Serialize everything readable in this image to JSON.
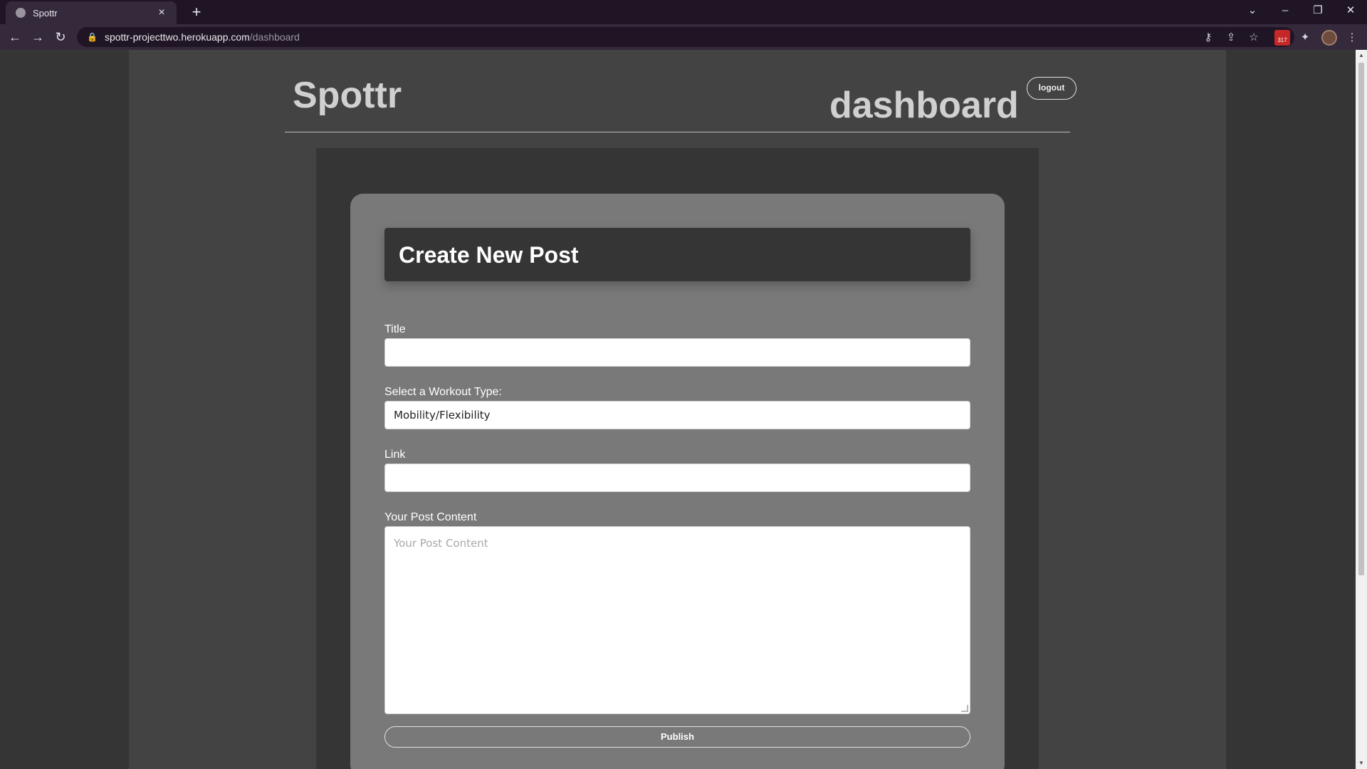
{
  "browser": {
    "tab_title": "Spottr",
    "url_host": "spottr-projecttwo.herokuapp.com",
    "url_path": "/dashboard",
    "extension_badge": "317"
  },
  "header": {
    "brand": "Spottr",
    "page_title": "dashboard",
    "logout_label": "logout"
  },
  "form": {
    "heading": "Create New Post",
    "title_label": "Title",
    "title_value": "",
    "workout_label": "Select a Workout Type:",
    "workout_value": "Mobility/Flexibility",
    "link_label": "Link",
    "link_value": "",
    "content_label": "Your Post Content",
    "content_placeholder": "Your Post Content",
    "publish_label": "Publish"
  },
  "icons": {
    "tab_favicon": "globe-icon",
    "back": "arrow-left-icon",
    "forward": "arrow-right-icon",
    "reload": "reload-icon",
    "lock": "lock-icon",
    "key": "key-icon",
    "share": "share-icon",
    "bookmark": "star-icon",
    "extensions": "puzzle-icon",
    "menu": "kebab-menu-icon"
  }
}
